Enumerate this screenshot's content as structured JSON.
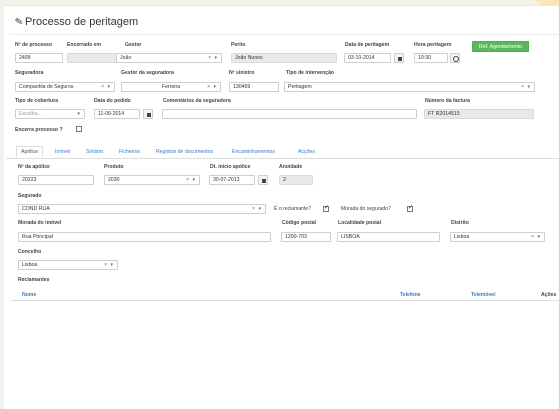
{
  "title": "Processo de peritagem",
  "row1": {
    "numero_label": "Nº de processo",
    "numero_value": "2409",
    "encerrado_label": "Encerrado em",
    "gestor_label": "Gestor",
    "gestor_value": "João",
    "perito_label": "Perito",
    "perito_value": "João Nunes",
    "data_label": "Data de peritagem",
    "data_value": "03-10-2014",
    "hora_label": "Hora peritagem",
    "hora_value": "10:30",
    "ref_button": "Ref. Agendamento"
  },
  "row2": {
    "seguradora_label": "Seguradora",
    "seguradora_value": "Companhia de Seguros",
    "gestor_seg_label": "Gestor da seguradora",
    "gestor_seg_value": "Ferreira",
    "sinistro_label": "Nº sinistro",
    "sinistro_value": "130469",
    "intervencao_label": "Tipo de intervenção",
    "intervencao_value": "Peritagem"
  },
  "row3": {
    "cobertura_label": "Tipo de cobertura",
    "cobertura_placeholder": "Escolha...",
    "pedido_label": "Data do pedido",
    "pedido_value": "11-06-2014",
    "comentarios_label": "Comentários da seguradora",
    "factura_label": "Número da factura",
    "factura_value": "FT R2014515"
  },
  "encerra_label": "Encerra processo ?",
  "tabs": [
    "Apólice",
    "Imóvel",
    "Sinistro",
    "Ficheiros",
    "Registos de documentos",
    "Encaminhamentos",
    "Acções"
  ],
  "policy": {
    "apolice_label": "Nº da apólice",
    "apolice_value": "20223",
    "produto_label": "Produto",
    "produto_value": "2030",
    "inicio_label": "Dt. início apólice",
    "inicio_value": "30-07-2013",
    "anuidade_label": "Anuidade",
    "anuidade_value": "2",
    "segurado_label": "Segurado",
    "segurado_value": "COND RUA",
    "reclamante_label": "É o reclamante?",
    "morada_seg_label": "Morada do segurado?",
    "morada_imovel_label": "Morada do imóvel",
    "morada_imovel_value": "Rua Principal",
    "codigo_label": "Código postal",
    "codigo_value": "1200-703",
    "localidade_label": "Localidade postal",
    "localidade_value": "LISBOA",
    "distrito_label": "Distrito",
    "distrito_value": "Lisboa",
    "concelho_label": "Concelho",
    "concelho_value": "Lisboa"
  },
  "reclamantes": {
    "title": "Reclamantes",
    "columns": [
      "Nome",
      "Telefone",
      "Telemóvel",
      "Ações"
    ]
  },
  "colors": {
    "link": "#3a7ac4",
    "button_green": "#5cb85c"
  }
}
